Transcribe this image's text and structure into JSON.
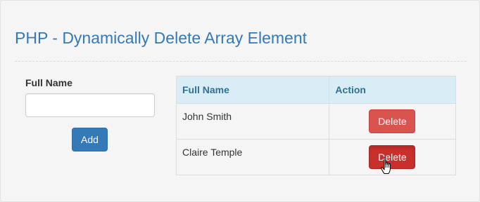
{
  "page": {
    "title": "PHP - Dynamically Delete Array Element"
  },
  "form": {
    "label": "Full Name",
    "input_value": "",
    "input_placeholder": "",
    "add_label": "Add"
  },
  "table": {
    "headers": [
      "Full Name",
      "Action"
    ],
    "rows": [
      {
        "name": "John Smith",
        "action_label": "Delete"
      },
      {
        "name": "Claire Temple",
        "action_label": "Delete"
      }
    ]
  },
  "colors": {
    "title": "#337ab7",
    "header_bg": "#d9edf7",
    "header_text": "#31708f",
    "add_button": "#337ab7",
    "delete_button": "#d9534f",
    "delete_button_active": "#c9302c"
  },
  "cursor": {
    "icon": "hand-pointer-icon"
  }
}
